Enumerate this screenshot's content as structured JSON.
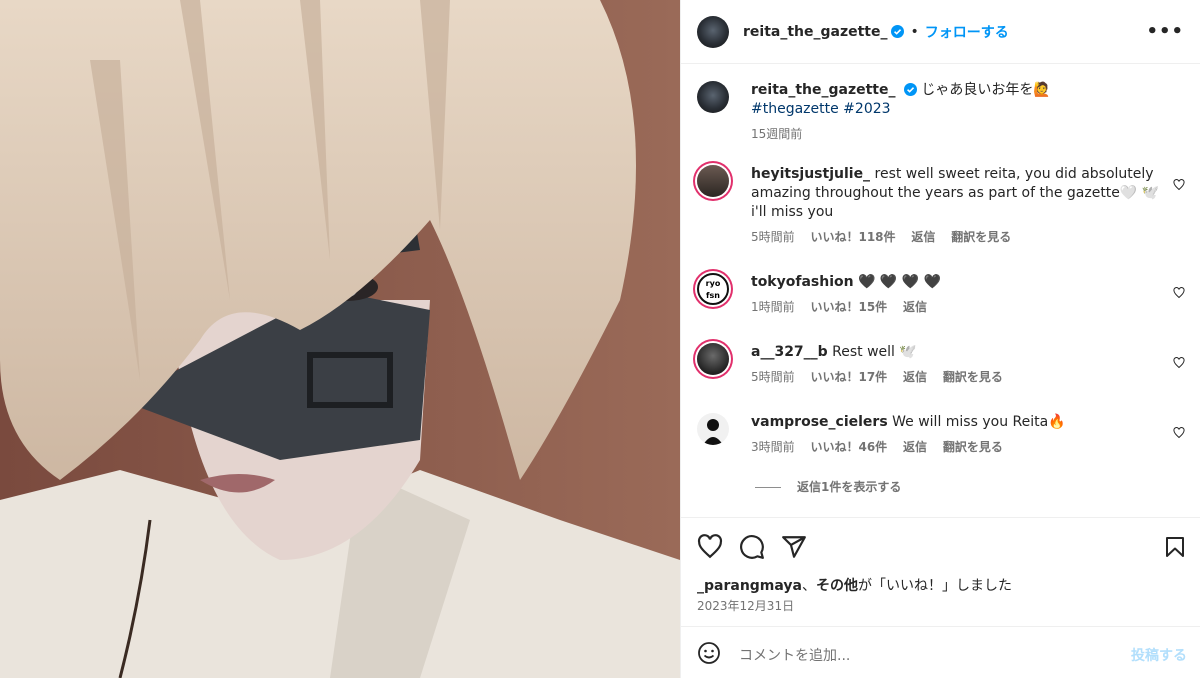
{
  "post": {
    "username": "reita_the_gazette_",
    "follow_label": "フォローする",
    "more_label": "•••",
    "caption": "じゃあ良いお年を🙋",
    "hashtags": "#thegazette #2023",
    "caption_time": "15週間前"
  },
  "comments": [
    {
      "user": "heyitsjustjulie_",
      "text": "rest well sweet reita, you did absolutely amazing throughout the years as part of the gazette🤍 🕊️ i'll miss you",
      "time": "5時間前",
      "likes": "いいね！118件",
      "reply": "返信",
      "translate": "翻訳を見る"
    },
    {
      "user": "tokyofashion",
      "text": "🖤 🖤 🖤 🖤",
      "time": "1時間前",
      "likes": "いいね！15件",
      "reply": "返信"
    },
    {
      "user": "a__327__b",
      "text": "Rest well 🕊️",
      "time": "5時間前",
      "likes": "いいね！17件",
      "reply": "返信",
      "translate": "翻訳を見る"
    },
    {
      "user": "vamprose_cielers",
      "text": "We will miss you Reita🔥",
      "time": "3時間前",
      "likes": "いいね！46件",
      "reply": "返信",
      "translate": "翻訳を見る"
    }
  ],
  "view_replies": "返信1件を表示する",
  "likes_line": {
    "user": "_parangmaya",
    "sep": "、",
    "others": "その他",
    "suffix": "が「いいね！」しました"
  },
  "date": "2023年12月31日",
  "add_comment": {
    "placeholder": "コメントを追加...",
    "post_label": "投稿する"
  },
  "icons": [
    "verified-icon",
    "more-icon",
    "heart-icon",
    "comment-icon",
    "share-icon",
    "bookmark-icon",
    "emoji-icon"
  ],
  "colors": {
    "accent": "#0095f6",
    "text": "#262626",
    "muted": "#737373"
  }
}
